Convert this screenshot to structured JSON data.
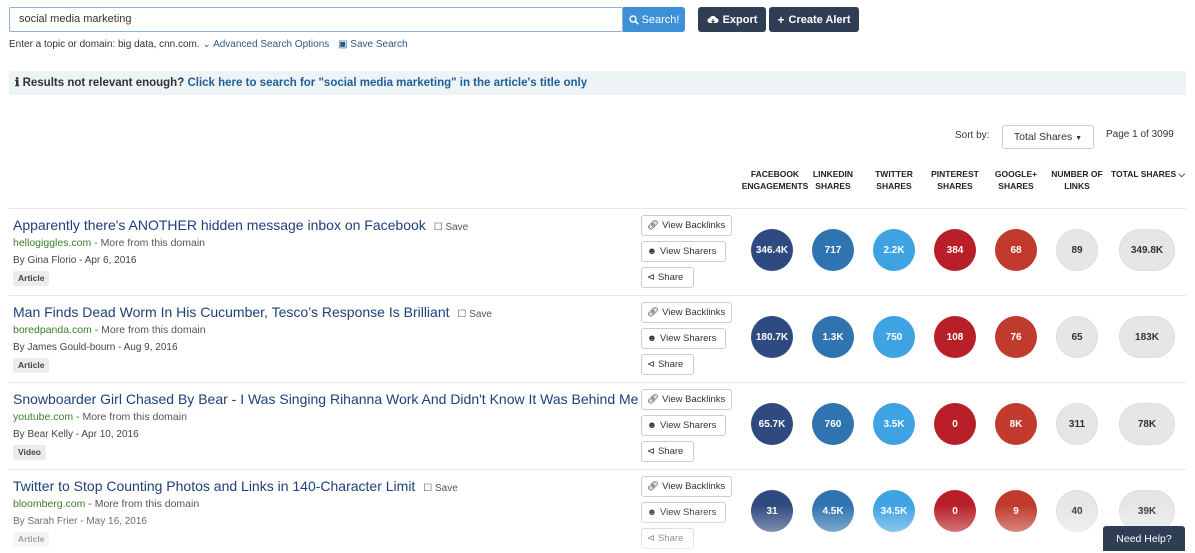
{
  "search": {
    "query": "social media marketing",
    "button_label": "Search!",
    "export_label": "Export",
    "create_alert_label": "Create Alert",
    "hint": "Enter a topic or domain: big data, cnn.com.",
    "advanced_label": "Advanced Search Options",
    "save_search_label": "Save Search"
  },
  "notice": {
    "prefix": "Results not relevant enough?",
    "link": "Click here to search for \"social media marketing\" in the article's title only"
  },
  "sort": {
    "label": "Sort by:",
    "selected": "Total Shares",
    "page_info": "Page 1 of 3099"
  },
  "columns": [
    {
      "line1": "Facebook",
      "line2": "Engagements"
    },
    {
      "line1": "LinkedIn",
      "line2": "Shares"
    },
    {
      "line1": "Twitter",
      "line2": "Shares"
    },
    {
      "line1": "Pinterest",
      "line2": "Shares"
    },
    {
      "line1": "Google+",
      "line2": "Shares"
    },
    {
      "line1": "Number of",
      "line2": "Links"
    },
    {
      "line1": "Total Shares",
      "line2": ""
    }
  ],
  "row_buttons": {
    "backlinks": "View Backlinks",
    "sharers": "View Sharers",
    "share": "Share",
    "save": "Save",
    "more_from_domain": "More from this domain"
  },
  "results": [
    {
      "title": "Apparently there's ANOTHER hidden message inbox on Facebook",
      "domain": "hellogiggles.com",
      "byline": "By Gina Florio - Apr 6, 2016",
      "type": "Article",
      "facebook": "346.4K",
      "linkedin": "717",
      "twitter": "2.2K",
      "pinterest": "384",
      "google": "68",
      "links": "89",
      "total": "349.8K"
    },
    {
      "title": "Man Finds Dead Worm In His Cucumber, Tesco’s Response Is Brilliant",
      "domain": "boredpanda.com",
      "byline": "By James Gould-bourn - Aug 9, 2016",
      "type": "Article",
      "facebook": "180.7K",
      "linkedin": "1.3K",
      "twitter": "750",
      "pinterest": "108",
      "google": "76",
      "links": "65",
      "total": "183K"
    },
    {
      "title": "Snowboarder Girl Chased By Bear - I Was Singing Rihanna Work And Didn't Know It Was Behind Me!",
      "domain": "youtube.com",
      "byline": "By Bear Kelly - Apr 10, 2016",
      "type": "Video",
      "facebook": "65.7K",
      "linkedin": "760",
      "twitter": "3.5K",
      "pinterest": "0",
      "google": "8K",
      "links": "311",
      "total": "78K"
    },
    {
      "title": "Twitter to Stop Counting Photos and Links in 140-Character Limit",
      "domain": "bloomberg.com",
      "byline": "By Sarah Frier - May 16, 2016",
      "type": "Article",
      "facebook": "31",
      "linkedin": "4.5K",
      "twitter": "34.5K",
      "pinterest": "0",
      "google": "9",
      "links": "40",
      "total": "39K"
    }
  ],
  "help_label": "Need Help?"
}
